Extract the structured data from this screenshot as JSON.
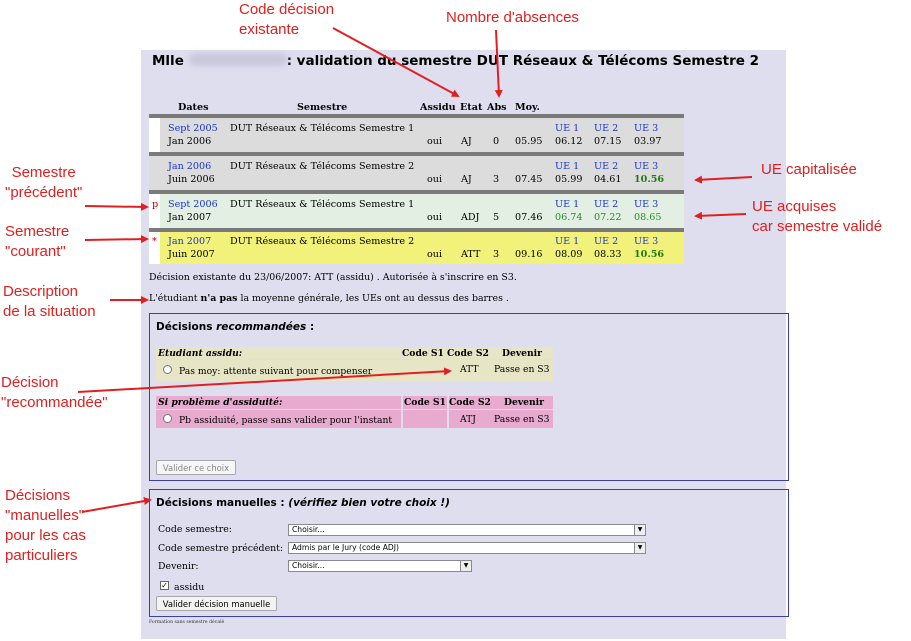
{
  "page": {
    "title_prefix": "Mlle",
    "title_suffix": ": validation du semestre DUT Réseaux & Télécoms Semestre 2"
  },
  "columns": {
    "dates": "Dates",
    "semestre": "Semestre",
    "assidu": "Assidu",
    "etat": "Etat",
    "abs": "Abs",
    "moy": "Moy."
  },
  "semesters": [
    {
      "marker": "",
      "start": "Sept 2005",
      "end": "Jan 2006",
      "name": "DUT Réseaux & Télécoms Semestre 1",
      "assidu": "oui",
      "etat": "AJ",
      "abs": "0",
      "moy": "05.95",
      "ue1_label": "UE 1",
      "ue2_label": "UE 2",
      "ue3_label": "UE 3",
      "ue1": "06.12",
      "ue2": "07.15",
      "ue3": "03.97"
    },
    {
      "marker": "",
      "start": "Jan 2006",
      "end": "Juin 2006",
      "name": "DUT Réseaux & Télécoms Semestre 2",
      "assidu": "oui",
      "etat": "AJ",
      "abs": "3",
      "moy": "07.45",
      "ue1_label": "UE 1",
      "ue2_label": "UE 2",
      "ue3_label": "UE 3",
      "ue1": "05.99",
      "ue2": "04.61",
      "ue3": "10.56"
    },
    {
      "marker": "p",
      "start": "Sept 2006",
      "end": "Jan 2007",
      "name": "DUT Réseaux & Télécoms Semestre 1",
      "assidu": "oui",
      "etat": "ADJ",
      "abs": "5",
      "moy": "07.46",
      "ue1_label": "UE 1",
      "ue2_label": "UE 2",
      "ue3_label": "UE 3",
      "ue1": "06.74",
      "ue2": "07.22",
      "ue3": "08.65"
    },
    {
      "marker": "*",
      "start": "Jan 2007",
      "end": "Juin 2007",
      "name": "DUT Réseaux & Télécoms Semestre 2",
      "assidu": "oui",
      "etat": "ATT",
      "abs": "3",
      "moy": "09.16",
      "ue1_label": "UE 1",
      "ue2_label": "UE 2",
      "ue3_label": "UE 3",
      "ue1": "08.09",
      "ue2": "08.33",
      "ue3": "10.56"
    }
  ],
  "decision_existante": "Décision existante du 23/06/2007: ATT (assidu) . Autorisée à s'inscrire en S3.",
  "situation": {
    "before": "L'étudiant ",
    "bold": "n'a pas",
    "after": " la moyenne générale, les UEs ont au dessus des barres ."
  },
  "recommended": {
    "title_plain": "Décisions ",
    "title_italic": "recommandées",
    "title_end": " :",
    "group1": {
      "heading": "Etudiant assidu:",
      "code_s1": "Code S1",
      "code_s2": "Code S2",
      "devenir": "Devenir",
      "option": "Pas moy: attente suivant pour compenser",
      "s2_value": "ATT",
      "devenir_value": "Passe en S3"
    },
    "group2": {
      "heading": "Si problème d'assiduité:",
      "code_s1": "Code S1",
      "code_s2": "Code S2",
      "devenir": "Devenir",
      "option": "Pb assiduité, passe sans valider pour l'instant",
      "s2_value": "ATJ",
      "devenir_value": "Passe en S3"
    },
    "button": "Valider ce choix"
  },
  "manual": {
    "title": "Décisions manuelles : ",
    "title_italic": "(vérifiez bien votre choix !)",
    "code_semestre_label": "Code semestre:",
    "code_semestre_value": "Choisir...",
    "code_prec_label": "Code semestre précédent:",
    "code_prec_value": "Admis par le Jury (code ADJ)",
    "devenir_label": "Devenir:",
    "devenir_value": "Choisir...",
    "assidu_label": "assidu",
    "assidu_checked": "✓",
    "button": "Valider décision manuelle"
  },
  "footnote": "Formation sans semestre décalé",
  "annotations": {
    "code_decision": "Code décision\nexistante",
    "nombre_absences": "Nombre d'absences",
    "semestre_precedent": "Semestre\n\"précédent\"",
    "semestre_courant": "Semestre\n\"courant\"",
    "description": "Description\nde la situation",
    "decision_recommandee": "Décision\n\"recommandée\"",
    "decisions_manuelles": "Décisions\n\"manuelles\"\npour les cas\nparticuliers",
    "ue_capitalisee": "UE capitalisée",
    "ue_acquises": "UE acquises\ncar semestre validé"
  },
  "colors": {
    "panel_bg": "#dedeef",
    "row_grey": "#dcdcdc",
    "row_green": "#e2efe2",
    "row_yellow": "#f2f27a",
    "table_bg": "#e6e6c6",
    "table_pink": "#e8aacf",
    "annotation_red": "#e02020",
    "link_blue": "#1a36c8"
  }
}
